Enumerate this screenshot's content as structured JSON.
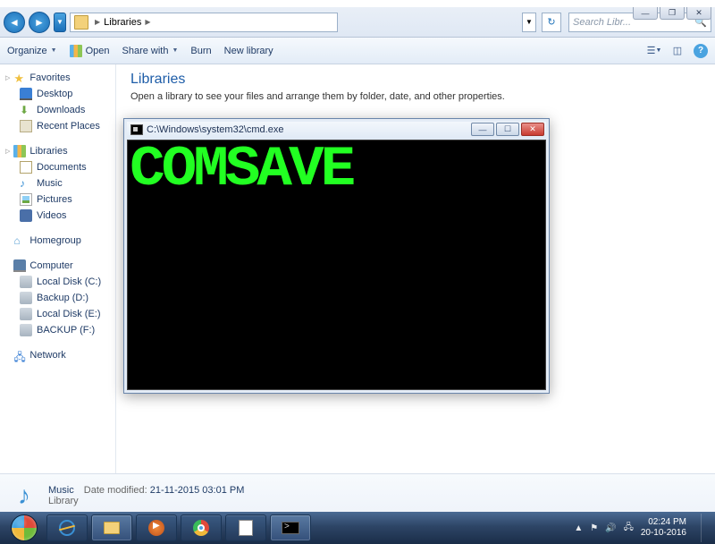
{
  "window_controls": {
    "min": "—",
    "max": "❐",
    "close": "✕"
  },
  "nav": {
    "breadcrumb_root_icon": "libraries",
    "breadcrumb": "Libraries",
    "search_placeholder": "Search Libr..."
  },
  "toolbar": {
    "organize": "Organize",
    "open": "Open",
    "share": "Share with",
    "burn": "Burn",
    "newlib": "New library"
  },
  "sidebar": {
    "favorites": {
      "head": "Favorites",
      "items": [
        "Desktop",
        "Downloads",
        "Recent Places"
      ]
    },
    "libraries": {
      "head": "Libraries",
      "items": [
        "Documents",
        "Music",
        "Pictures",
        "Videos"
      ]
    },
    "homegroup": {
      "head": "Homegroup"
    },
    "computer": {
      "head": "Computer",
      "items": [
        "Local Disk (C:)",
        "Backup (D:)",
        "Local Disk  (E:)",
        "BACKUP (F:)"
      ]
    },
    "network": {
      "head": "Network"
    }
  },
  "content": {
    "title": "Libraries",
    "subtitle": "Open a library to see your files and arrange them by folder, date, and other properties."
  },
  "cmd": {
    "title": "C:\\Windows\\system32\\cmd.exe",
    "ascii": "COMSAVE",
    "min": "—",
    "max": "☐",
    "close": "✕"
  },
  "details": {
    "name": "Music",
    "modified_label": "Date modified:",
    "modified_value": "21-11-2015  03:01 PM",
    "type": "Library"
  },
  "tray": {
    "time": "02:24 PM",
    "date": "20-10-2016"
  }
}
